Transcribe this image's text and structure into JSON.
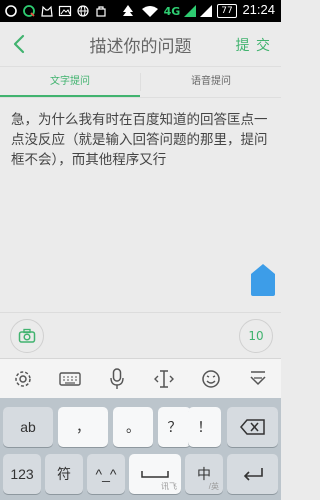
{
  "status_bar": {
    "battery": "77",
    "network": "4G",
    "time": "21:24"
  },
  "header": {
    "title": "描述你的问题",
    "submit_label": "提 交"
  },
  "tabs": [
    {
      "label": "文字提问",
      "active": true
    },
    {
      "label": "语音提问",
      "active": false
    }
  ],
  "editor": {
    "text": "急，为什么我有时在百度知道的回答匡点一点没反应（就是输入回答问题的那里，提问框不会），而其他程序又行"
  },
  "tool_row": {
    "char_count": "10"
  },
  "keyboard": {
    "row1": [
      "ab",
      "，",
      "。",
      "？",
      "！"
    ],
    "row2": [
      "123",
      "符",
      "^_^",
      "",
      "中",
      ""
    ],
    "space_sub": "讯飞",
    "lang_sub": "/英"
  },
  "colors": {
    "accent": "#41b36f",
    "background": "#ebebeb",
    "handle": "#3d9de8"
  }
}
